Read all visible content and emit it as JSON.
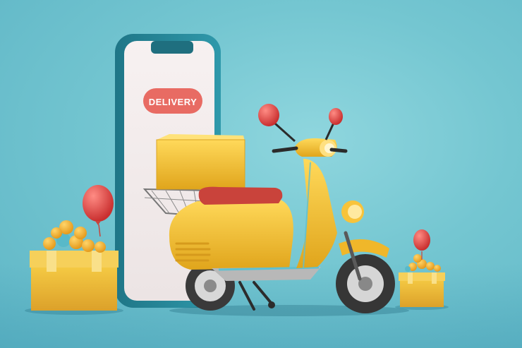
{
  "scene": {
    "badge_text": "DELIVERY",
    "background_color": "#74c6d1",
    "phone_frame_color": "#2a8a9c",
    "phone_screen_color": "#f5eeee",
    "badge_color": "#e86b63",
    "scooter_color": "#f2bc2c",
    "seat_color": "#c9433b",
    "balloon_color": "#e3423f",
    "box_color": "#f4c434"
  }
}
